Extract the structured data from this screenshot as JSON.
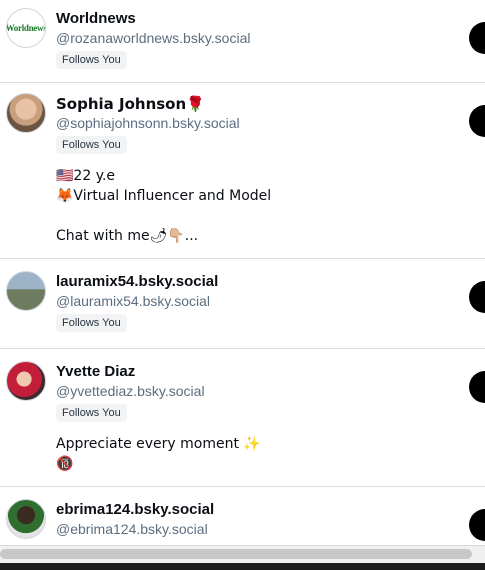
{
  "follow_badge": "Follows You",
  "users": [
    {
      "display_name": "Worldnews",
      "handle": "@rozanaworldnews.bsky.social",
      "avatar_text": "Worldnews"
    },
    {
      "display_name": "Sophia Johnson🌹",
      "handle": "@sophiajohnsonn.bsky.social",
      "bio": "🇺🇸22 y.e\n🦊Virtual Influencer and Model\n\nChat with me🌶👇🏼..."
    },
    {
      "display_name": "lauramix54.bsky.social",
      "handle": "@lauramix54.bsky.social"
    },
    {
      "display_name": "Yvette Diaz",
      "handle": "@yvettediaz.bsky.social",
      "bio": "Appreciate every moment ✨\n🔞"
    },
    {
      "display_name": "ebrima124.bsky.social",
      "handle": "@ebrima124.bsky.social"
    }
  ],
  "icons": {
    "follow": "follow-button-icon",
    "scrollbar": "horizontal-scrollbar"
  }
}
